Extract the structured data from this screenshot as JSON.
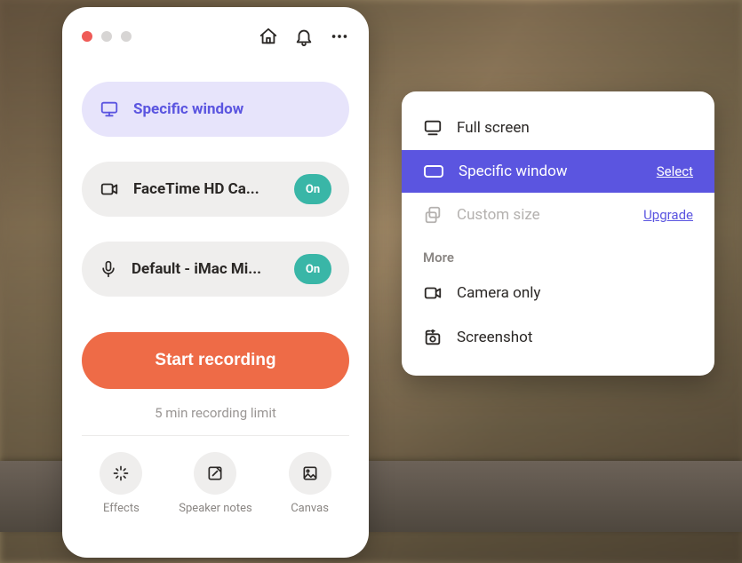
{
  "colors": {
    "accent": "#5b55e0",
    "primary": "#ee6b47",
    "badge": "#39b6a7"
  },
  "panel": {
    "window_option": {
      "label": "Specific window"
    },
    "camera": {
      "label": "FaceTime HD Ca...",
      "status": "On"
    },
    "mic": {
      "label": "Default - iMac Mi...",
      "status": "On"
    },
    "start_button": "Start recording",
    "limit_text": "5 min recording limit",
    "tools": {
      "effects": "Effects",
      "speaker_notes": "Speaker notes",
      "canvas": "Canvas"
    }
  },
  "popover": {
    "items": [
      {
        "icon": "monitor",
        "label": "Full screen"
      },
      {
        "icon": "window",
        "label": "Specific window",
        "action": "Select",
        "selected": true
      },
      {
        "icon": "custom-size",
        "label": "Custom size",
        "action": "Upgrade",
        "disabled": true
      }
    ],
    "more_header": "More",
    "more_items": [
      {
        "icon": "camera",
        "label": "Camera only"
      },
      {
        "icon": "screenshot",
        "label": "Screenshot"
      }
    ]
  }
}
